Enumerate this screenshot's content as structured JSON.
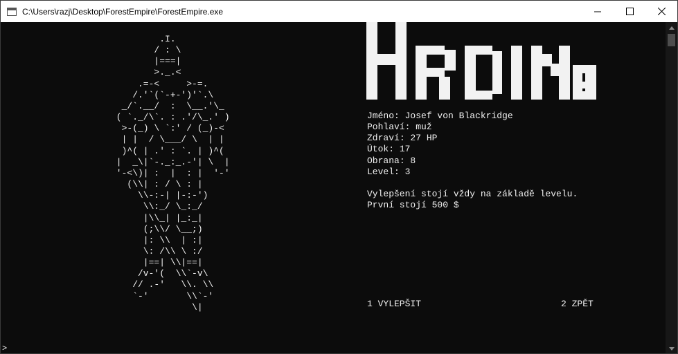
{
  "window": {
    "title": "C:\\Users\\razj\\Desktop\\ForestEmpire\\ForestEmpire.exe",
    "controls": [
      "minimize-icon",
      "maximize-icon",
      "close-icon"
    ]
  },
  "colors": {
    "console_bg": "#0c0c0c",
    "console_text": "#f2f2f2",
    "titlebar_bg": "#ffffff"
  },
  "screen": {
    "heading": "Hrdina",
    "ascii_art": "         .I.\n        / : \\\n        |===|\n        >._.<\n     .=-<     >-=.\n    /.'`(`-+-')'`.\\\n  _/`.__/  :  \\__.'\\_\n ( `._/\\`. : .'/\\_.' )\n  >-(_) \\ `:' / (_)-<\n  | |  / \\___/ \\  | |\n  )^( | .' : `. | )^(\n |  _\\|`-._:_.-'| \\  |\n '-<\\)| :  |  : |  '-'\n   (\\\\| : / \\ : |\n     \\\\-:-| |-:-')\n      \\\\:_/ \\_:_/\n      |\\\\_| |_:_|\n      (;\\\\/ \\__;)\n      |: \\\\  | :|\n      \\: /\\\\ \\ :/\n      |==| \\\\|==|\n     /v-'(  \\\\`-v\\\n    // .-'   \\\\. \\\\\n    `-'       \\\\`-'\n               \\|",
    "stats": [
      {
        "label": "Jméno",
        "value": "Josef von Blackridge"
      },
      {
        "label": "Pohlaví",
        "value": "muž"
      },
      {
        "label": "Zdraví",
        "value": "27 HP"
      },
      {
        "label": "Útok",
        "value": "17"
      },
      {
        "label": "Obrana",
        "value": "8"
      },
      {
        "label": "Level",
        "value": "3"
      }
    ],
    "upgrade_note": "Vylepšení stojí vždy na základě levelu.",
    "first_cost": "První stojí 500 $",
    "menu": {
      "upgrade": "1 VYLEPŠIT",
      "back": "2 ZPĚT"
    },
    "prompt": ">"
  }
}
